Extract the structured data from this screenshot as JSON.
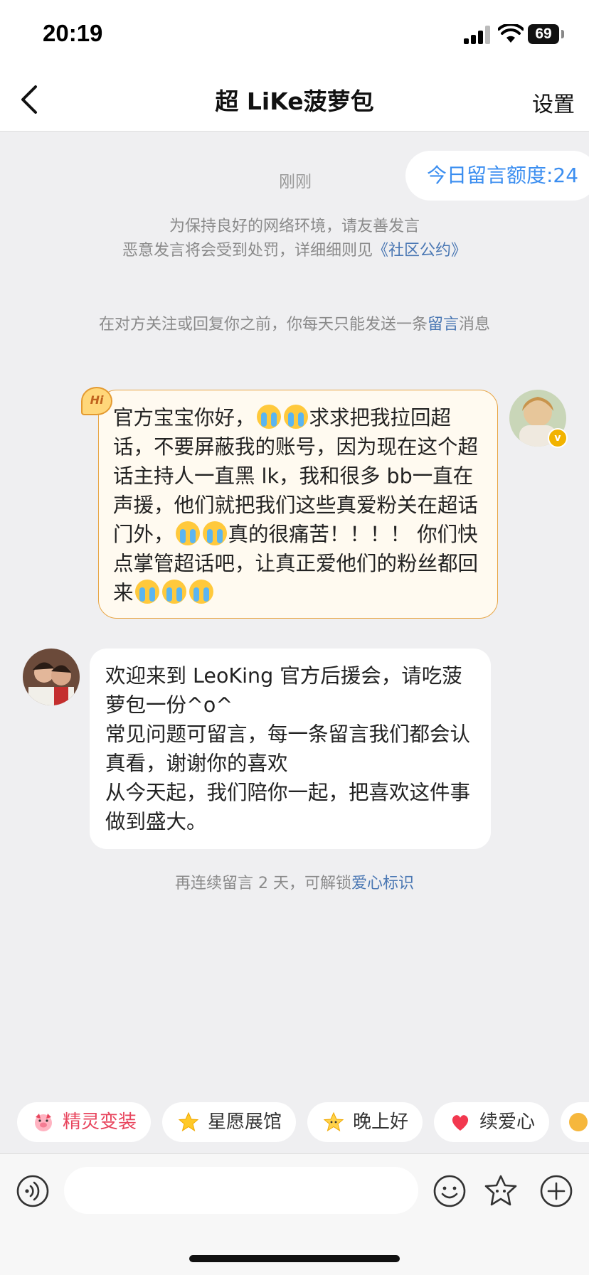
{
  "status": {
    "time": "20:19",
    "battery": "69"
  },
  "nav": {
    "title": "超 LiKe菠萝包",
    "settings": "设置"
  },
  "chat": {
    "quota": "今日留言额度:24",
    "time_label": "刚刚",
    "notice_line1": "为保持良好的网络环境，请友善发言",
    "notice_line2_prefix": "恶意发言将会受到处罚，详细细则见",
    "notice_line2_link": "《社区公约》",
    "rule_prefix": "在对方关注或回复你之前，你每天只能发送一条",
    "rule_link": "留言",
    "rule_suffix": "消息",
    "my_message": {
      "badge": "Hi",
      "part1": "官方宝宝你好，",
      "part2": "求求把我拉回超话，不要屏蔽我的账号，因为现在这个超话主持人一直黑 lk，我和很多 bb一直在声援，他们就把我们这些真爱粉关在超话门外，",
      "part3": "真的很痛苦！！！！ 你们快点掌管超话吧，让真正爱他们的粉丝都回来"
    },
    "reply_message": {
      "line1": "欢迎来到 LeoKing 官方后援会，请吃菠萝包一份^o^",
      "line2": "常见问题可留言，每一条留言我们都会认真看，谢谢你的喜欢",
      "line3": "从今天起，我们陪你一起，把喜欢这件事做到盛大。"
    },
    "unlock_prefix": "再连续留言 2 天，可解锁",
    "unlock_link": "爱心标识"
  },
  "chips": [
    {
      "label": "精灵变装",
      "icon": "pig-sprite-icon",
      "color": "#e8455d"
    },
    {
      "label": "星愿展馆",
      "icon": "star-icon",
      "color": "#333333"
    },
    {
      "label": "晚上好",
      "icon": "star-face-icon",
      "color": "#333333"
    },
    {
      "label": "续爱心",
      "icon": "heart-icon",
      "color": "#333333"
    }
  ],
  "input": {
    "placeholder": ""
  },
  "colors": {
    "accent": "#3b8ef0",
    "link": "#4a77b3",
    "my_bubble_border": "#e8a544",
    "my_bubble_bg": "#fffaf0"
  }
}
